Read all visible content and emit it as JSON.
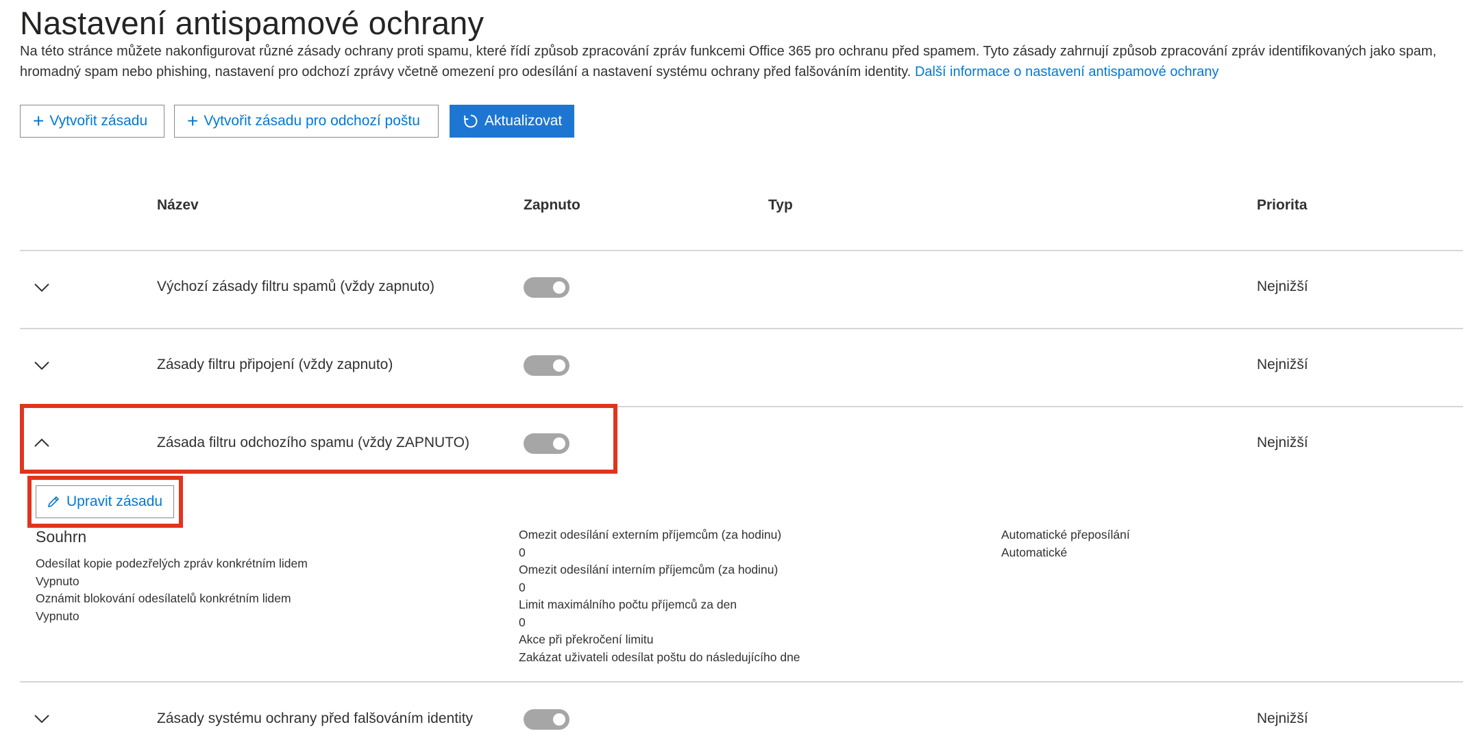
{
  "page": {
    "title": "Nastavení antispamové ochrany",
    "description": "Na této stránce můžete nakonfigurovat různé zásady ochrany proti spamu, které řídí způsob zpracování zpráv funkcemi Office 365 pro ochranu před spamem. Tyto zásady zahrnují způsob zpracování zpráv identifikovaných jako spam, hromadný spam nebo phishing, nastavení pro odchozí zprávy včetně omezení pro odesílání a nastavení systému ochrany před falšováním identity.",
    "learn_more_link": "Další informace o nastavení antispamové ochrany"
  },
  "toolbar": {
    "create_policy": "Vytvořit zásadu",
    "create_outbound_policy": "Vytvořit zásadu pro odchozí poštu",
    "refresh": "Aktualizovat"
  },
  "table": {
    "columns": {
      "name": "Název",
      "enabled": "Zapnuto",
      "type": "Typ",
      "priority": "Priorita"
    },
    "rows": [
      {
        "name": "Výchozí zásady filtru spamů (vždy zapnuto)",
        "priority": "Nejnižší",
        "expanded": false,
        "enabled": true
      },
      {
        "name": "Zásady filtru připojení (vždy zapnuto)",
        "priority": "Nejnižší",
        "expanded": false,
        "enabled": true
      },
      {
        "name": "Zásada filtru odchozího spamu (vždy ZAPNUTO)",
        "priority": "Nejnižší",
        "expanded": true,
        "enabled": true
      },
      {
        "name": "Zásady systému ochrany před falšováním identity",
        "priority": "Nejnižší",
        "expanded": false,
        "enabled": true
      }
    ]
  },
  "details": {
    "edit_button": "Upravit zásadu",
    "summary_title": "Souhrn",
    "col1": [
      {
        "label": "Odesílat kopie podezřelých zpráv konkrétním lidem",
        "value": "Vypnuto"
      },
      {
        "label": "Oznámit blokování odesílatelů konkrétním lidem",
        "value": "Vypnuto"
      }
    ],
    "col2": [
      {
        "label": "Omezit odesílání externím příjemcům (za hodinu)",
        "value": "0"
      },
      {
        "label": "Omezit odesílání interním příjemcům (za hodinu)",
        "value": "0"
      },
      {
        "label": "Limit maximálního počtu příjemců za den",
        "value": "0"
      },
      {
        "label": "Akce při překročení limitu",
        "value": "Zakázat uživateli odesílat poštu do následujícího dne"
      }
    ],
    "col3": [
      {
        "label": "Automatické přeposílání",
        "value": "Automatické"
      }
    ]
  },
  "colors": {
    "accent": "#0078d4",
    "primary_button": "#1e76d3",
    "highlight": "#e2341d",
    "toggle_disabled": "#a6a6a6"
  },
  "icons": {
    "add": "plus-icon",
    "refresh": "refresh-icon",
    "edit": "pencil-icon",
    "collapse": "chevron-up-icon",
    "expand": "chevron-down-icon"
  }
}
